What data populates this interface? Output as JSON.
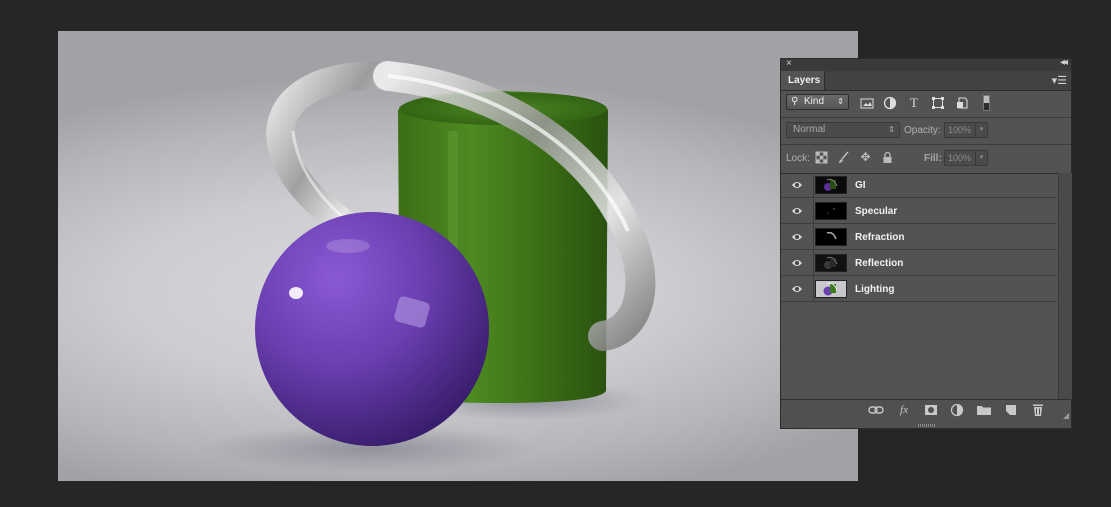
{
  "panel": {
    "close_label": "×",
    "collapse_label": "◂◂",
    "tab_label": "Layers",
    "menu_label": "▾☰"
  },
  "filter": {
    "kind_label": "Kind",
    "icons": [
      "image-filter-icon",
      "adjustment-filter-icon",
      "type-filter-icon",
      "shape-filter-icon",
      "smart-object-filter-icon"
    ]
  },
  "blend": {
    "mode": "Normal",
    "opacity_label": "Opacity:",
    "opacity_value": "100%"
  },
  "lock": {
    "label": "Lock:",
    "fill_label": "Fill:",
    "fill_value": "100%"
  },
  "layers": [
    {
      "name": "GI"
    },
    {
      "name": "Specular"
    },
    {
      "name": "Refraction"
    },
    {
      "name": "Reflection"
    },
    {
      "name": "Lighting"
    }
  ],
  "footer_icons": [
    "link-layers-icon",
    "fx-icon",
    "add-mask-icon",
    "new-adjustment-icon",
    "new-group-icon",
    "new-layer-icon",
    "delete-layer-icon"
  ],
  "colors": {
    "workspace": "#262626",
    "panel": "#535353",
    "sphere": "#6a3fb0",
    "cylinder": "#3f7a1e"
  }
}
